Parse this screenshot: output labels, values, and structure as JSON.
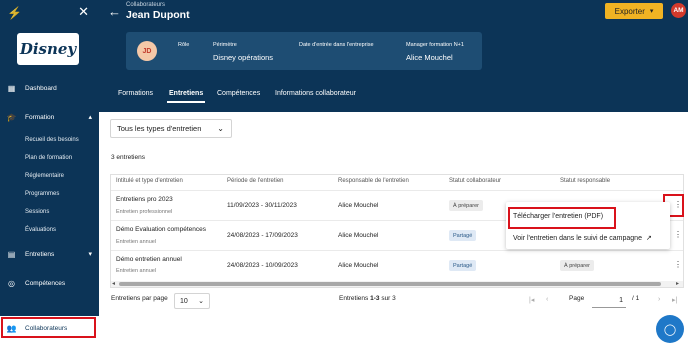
{
  "sidebar": {
    "menu_items": [
      {
        "label": "Dashboard",
        "icon": "dashboard-icon"
      },
      {
        "label": "Formation",
        "icon": "graduation-cap-icon"
      },
      {
        "label": "Entretiens",
        "icon": "chat-icon"
      },
      {
        "label": "Compétences",
        "icon": "target-icon"
      },
      {
        "label": "Collaborateurs",
        "icon": "people-icon"
      }
    ],
    "formation_sub": [
      "Recueil des besoins",
      "Plan de formation",
      "Réglementaire",
      "Programmes",
      "Sessions",
      "Évaluations"
    ]
  },
  "header": {
    "breadcrumb": "Collaborateurs",
    "person_name": "Jean Dupont",
    "export_label": "Exporter",
    "avatar_initials": "AM",
    "brand_color": "#0c3457",
    "accent_color": "#f0b323"
  },
  "profile_card": {
    "initials": "JD",
    "role_label": "Rôle",
    "perimeter_label": "Périmètre",
    "perimeter_value": "Disney opérations",
    "entry_label": "Date d'entrée dans l'entreprise",
    "manager_label": "Manager formation N+1",
    "manager_value": "Alice Mouchel"
  },
  "tabs": [
    "Formations",
    "Entretiens",
    "Compétences",
    "Informations collaborateur"
  ],
  "filter": {
    "selected": "Tous les types d'entretien"
  },
  "count_text": "3 entretiens",
  "table": {
    "headers": [
      "Intitulé et type d'entretien",
      "Période de l'entretien",
      "Responsable de l'entretien",
      "Statut collaborateur",
      "Statut responsable"
    ],
    "rows": [
      {
        "title": "Entretiens pro 2023",
        "type": "Entretien professionnel",
        "period": "11/09/2023 - 30/11/2023",
        "manager": "Alice Mouchel",
        "status_collab": "À préparer",
        "status_resp": ""
      },
      {
        "title": "Démo Evaluation compétences",
        "type": "Entretien annuel",
        "period": "24/08/2023 - 17/09/2023",
        "manager": "Alice Mouchel",
        "status_collab": "Partagé",
        "status_resp": ""
      },
      {
        "title": "Démo entretien annuel",
        "type": "Entretien annuel",
        "period": "24/08/2023 - 10/09/2023",
        "manager": "Alice Mouchel",
        "status_collab": "Partagé",
        "status_resp": "À préparer"
      }
    ]
  },
  "context_menu": {
    "download_label": "Télécharger l'entretien (PDF)",
    "view_label": "Voir l'entretien dans le suivi de campagne"
  },
  "pagination": {
    "per_page_label": "Entretiens par page",
    "per_page_value": "10",
    "range_prefix": "Entretiens",
    "range": "1-3",
    "range_suffix": "sur 3",
    "page_label": "Page",
    "page_value": "1",
    "page_total": "/ 1"
  }
}
